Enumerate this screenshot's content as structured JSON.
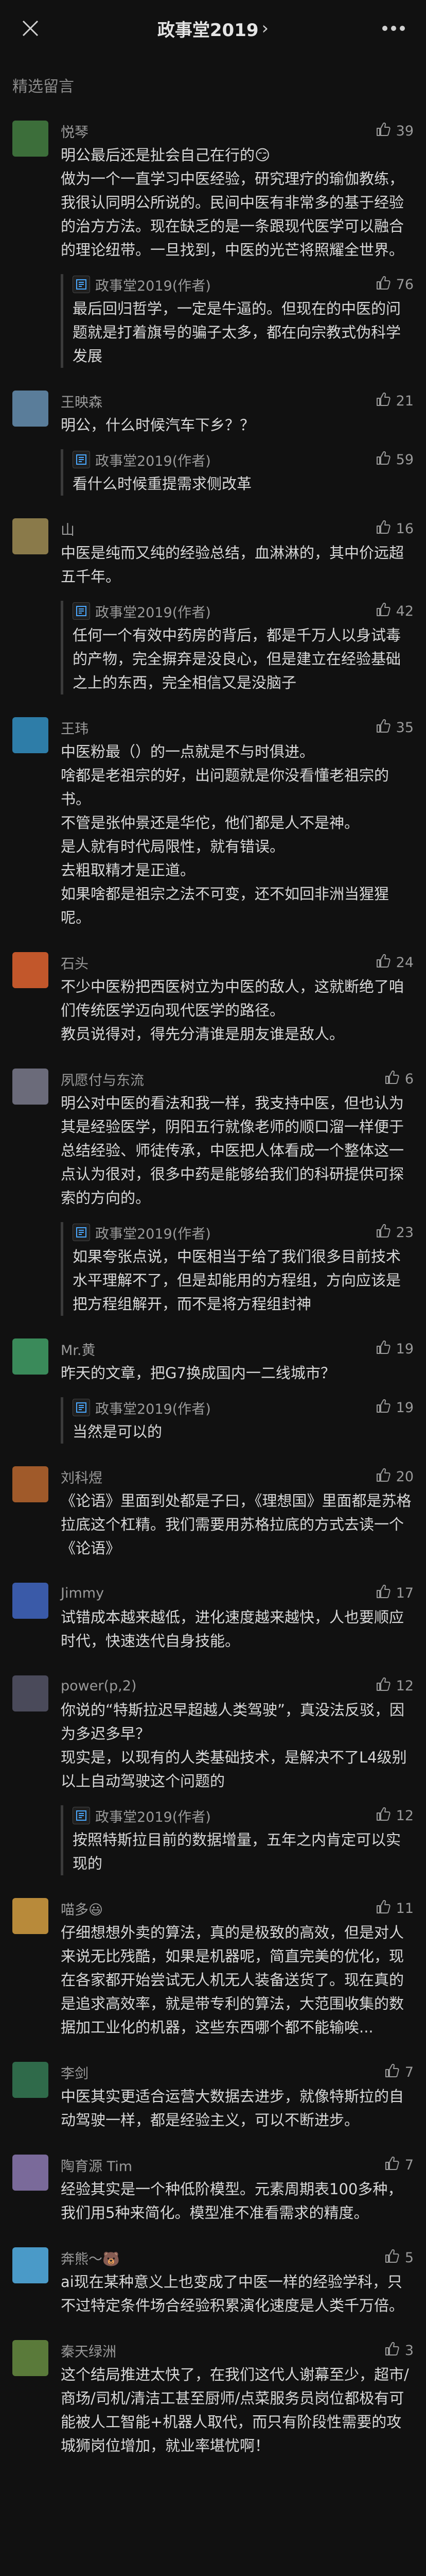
{
  "header": {
    "title": "政事堂2019",
    "chevron": "›",
    "close_icon": "close-icon",
    "more_icon": "more-icon"
  },
  "section_label": "精选留言",
  "colors": {
    "background": "#111111",
    "text": "#d8d8d8",
    "secondary": "#9a9a9a",
    "accent": "#4aa8ff"
  },
  "comments": [
    {
      "user": "悦琴",
      "likes": "39",
      "avatar_color": "#3c6e3a",
      "text": "明公最后还是扯会自己在行的😏\n做为一个一直学习中医经验，研究理疗的瑜伽教练，我很认同明公所说的。民间中医有非常多的基于经验的治方方法。现在缺乏的是一条跟现代医学可以融合的理论纽带。一旦找到，中医的光芒将照耀全世界。",
      "reply": {
        "author": "政事堂2019(作者)",
        "likes": "76",
        "text": "最后回归哲学，一定是牛逼的。但现在的中医的问题就是打着旗号的骗子太多，都在向宗教式伪科学发展"
      }
    },
    {
      "user": "王映森",
      "likes": "21",
      "avatar_color": "#5a7d9a",
      "text": "明公，什么时候汽车下乡？？",
      "reply": {
        "author": "政事堂2019(作者)",
        "likes": "59",
        "text": "看什么时候重提需求侧改革"
      }
    },
    {
      "user": "山",
      "likes": "16",
      "avatar_color": "#8a7a4a",
      "text": "中医是纯而又纯的经验总结，血淋淋的，其中价远超五千年。",
      "reply": {
        "author": "政事堂2019(作者)",
        "likes": "42",
        "text": "任何一个有效中药房的背后，都是千万人以身试毒的产物，完全摒弃是没良心，但是建立在经验基础之上的东西，完全相信又是没脑子"
      }
    },
    {
      "user": "王玮",
      "likes": "35",
      "avatar_color": "#2e7da8",
      "text": "中医粉最（）的一点就是不与时俱进。\n啥都是老祖宗的好，出问题就是你没看懂老祖宗的书。\n不管是张仲景还是华佗，他们都是人不是神。\n是人就有时代局限性，就有错误。\n去粗取精才是正道。\n如果啥都是祖宗之法不可变，还不如回非洲当猩猩呢。",
      "reply": null
    },
    {
      "user": "石头",
      "likes": "24",
      "avatar_color": "#c2572b",
      "text": "不少中医粉把西医树立为中医的敌人，这就断绝了咱们传统医学迈向现代医学的路径。\n教员说得对，得先分清谁是朋友谁是敌人。",
      "reply": null
    },
    {
      "user": "夙愿付与东流",
      "likes": "6",
      "avatar_color": "#6b6b7a",
      "text": "明公对中医的看法和我一样，我支持中医，但也认为其是经验医学，阴阳五行就像老师的顺口溜一样便于总结经验、师徒传承，中医把人体看成一个整体这一点认为很对，很多中药是能够给我们的科研提供可探索的方向的。",
      "reply": {
        "author": "政事堂2019(作者)",
        "likes": "23",
        "text": "如果夸张点说，中医相当于给了我们很多目前技术水平理解不了，但是却能用的方程组，方向应该是把方程组解开，而不是将方程组封神"
      }
    },
    {
      "user": "Mr.黄",
      "likes": "19",
      "avatar_color": "#3a8a5a",
      "text": "昨天的文章，把G7换成国内一二线城市？",
      "reply": {
        "author": "政事堂2019(作者)",
        "likes": "19",
        "text": "当然是可以的"
      }
    },
    {
      "user": "刘科煜",
      "likes": "20",
      "avatar_color": "#a05a2a",
      "text": "《论语》里面到处都是子曰，《理想国》里面都是苏格拉底这个杠精。我们需要用苏格拉底的方式去读一个《论语》",
      "reply": null
    },
    {
      "user": "Jimmy",
      "likes": "17",
      "avatar_color": "#3a5aa8",
      "text": "试错成本越来越低，进化速度越来越快，人也要顺应时代，快速迭代自身技能。",
      "reply": null
    },
    {
      "user": "power(p,2)",
      "likes": "12",
      "avatar_color": "#4a4a5a",
      "text": "你说的“特斯拉迟早超越人类驾驶”，真没法反驳，因为多迟多早？\n现实是，以现有的人类基础技术，是解决不了L4级别以上自动驾驶这个问题的",
      "reply": {
        "author": "政事堂2019(作者)",
        "likes": "12",
        "text": "按照特斯拉目前的数据增量，五年之内肯定可以实现的"
      }
    },
    {
      "user": "喵多😃",
      "likes": "11",
      "avatar_color": "#b88a3a",
      "text": "仔细想想外卖的算法，真的是极致的高效，但是对人来说无比残酷，如果是机器呢，简直完美的优化，现在各家都开始尝试无人机无人装备送货了。现在真的是追求高效率，就是带专利的算法，大范围收集的数据加工业化的机器，这些东西哪个都不能输唉...",
      "reply": null
    },
    {
      "user": "李剑",
      "likes": "7",
      "avatar_color": "#2f6a4a",
      "text": "中医其实更适合运营大数据去进步，就像特斯拉的自动驾驶一样，都是经验主义，可以不断进步。",
      "reply": null
    },
    {
      "user": "陶育源 Tim",
      "likes": "7",
      "avatar_color": "#7a6a9a",
      "text": "经验其实是一个种低阶模型。元素周期表100多种，我们用5种来简化。模型准不准看需求的精度。",
      "reply": null
    },
    {
      "user": "奔熊～🐻",
      "likes": "5",
      "avatar_color": "#4a9ac8",
      "text": "ai现在某种意义上也变成了中医一样的经验学科，只不过特定条件场合经验积累演化速度是人类千万倍。",
      "reply": null
    },
    {
      "user": "秦天绿洲",
      "likes": "3",
      "avatar_color": "#5a7a3a",
      "text": "这个结局推进太快了，在我们这代人谢幕至少，超市/商场/司机/清洁工甚至厨师/点菜服务员岗位都极有可能被人工智能+机器人取代，而只有阶段性需要的攻城狮岗位增加，就业率堪忧啊！",
      "reply": null
    }
  ]
}
